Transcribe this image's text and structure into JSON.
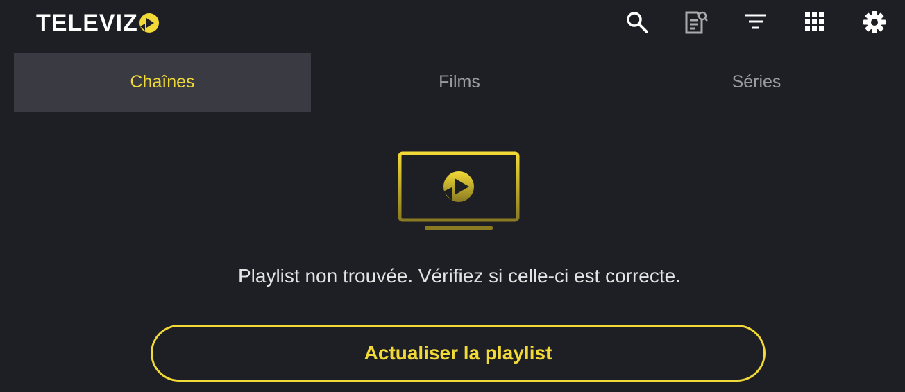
{
  "app": {
    "logo_text": "TELEVIZ",
    "brand_color": "#f1d937"
  },
  "toolbar": {
    "icons": [
      "search-icon",
      "epg-search-icon",
      "sort-icon",
      "grid-icon",
      "gear-icon"
    ]
  },
  "tabs": [
    {
      "label": "Chaînes",
      "active": true
    },
    {
      "label": "Films",
      "active": false
    },
    {
      "label": "Séries",
      "active": false
    }
  ],
  "empty_state": {
    "illustration": "tv-play-icon",
    "message": "Playlist non trouvée. Vérifiez si celle-ci est correcte.",
    "button_label": "Actualiser la playlist"
  }
}
